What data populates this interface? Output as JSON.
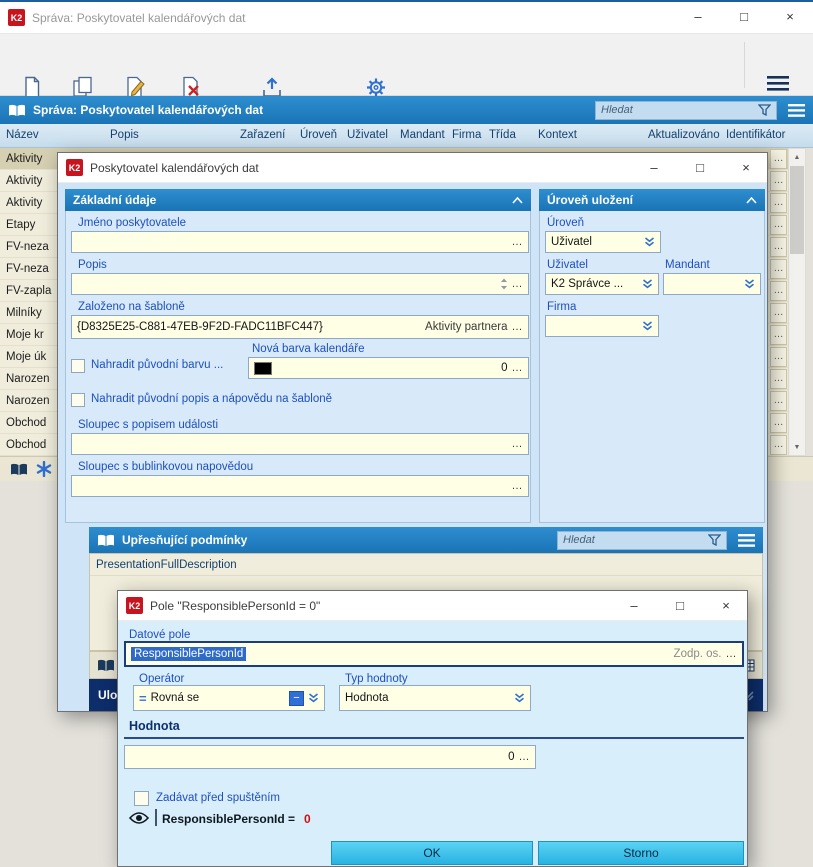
{
  "branding": {
    "k2": "K2"
  },
  "icons": {
    "ellipsis": "…",
    "minimize": "–",
    "maximize": "□",
    "close": "×",
    "caret_down": "▾",
    "scroll_up": "▲",
    "scroll_down": "▼",
    "minus": "−",
    "equals": "="
  },
  "main_window": {
    "title": "Správa: Poskytovatel kalendářových dat",
    "toolbar": {
      "new": "Nový",
      "copy": "Kopie",
      "change": "Změna",
      "delete": "Smazat",
      "export_import": "Export/import",
      "service_mode": "Servisní režim",
      "menu": "Menu"
    },
    "panel": {
      "title": "Správa: Poskytovatel kalendářových dat",
      "search_placeholder": "Hledat"
    },
    "table": {
      "columns": [
        "Název",
        "Popis",
        "Zařazení",
        "Úroveň",
        "Uživatel",
        "Mandant",
        "Firma",
        "Třída",
        "Kontext",
        "Aktualizováno",
        "Identifikátor"
      ],
      "rows": [
        "Aktivity",
        "Aktivity",
        "Aktivity",
        "Etapy",
        "FV-neza",
        "FV-neza",
        "FV-zapla",
        "Milníky",
        "Moje kr",
        "Moje úk",
        "Narozen",
        "Narozen",
        "Obchod",
        "Obchod"
      ]
    }
  },
  "provider_dialog": {
    "title": "Poskytovatel kalendářových dat",
    "basic": {
      "title": "Základní údaje",
      "name_label": "Jméno poskytovatele",
      "desc_label": "Popis",
      "template_label": "Založeno na šabloně",
      "template_guid": "{D8325E25-C881-47EB-9F2D-FADC11BFC447}",
      "template_name": "Aktivity partnera",
      "replace_color_label": "Nahradit původní barvu ...",
      "new_color_label": "Nová barva kalendáře",
      "new_color_value": "0",
      "replace_desc_label": "Nahradit původní popis a nápovědu na šabloně",
      "event_col_label": "Sloupec s popisem události",
      "hint_col_label": "Sloupec s bublinkovou napovědou"
    },
    "level": {
      "title": "Úroveň uložení",
      "level_label": "Úroveň",
      "level_value": "Uživatel",
      "user_label": "Uživatel",
      "user_value": "K2 Správce ...",
      "mandant_label": "Mandant",
      "firma_label": "Firma"
    },
    "conditions": {
      "title": "Upřesňující podmínky",
      "search_placeholder": "Hledat",
      "row1": "PresentationFullDescription",
      "save_label": "Uložit"
    }
  },
  "field_dialog": {
    "title": "Pole \"ResponsiblePersonId = 0\"",
    "field_label": "Datové pole",
    "field_value": "ResponsiblePersonId",
    "field_suffix": "Zodp. os.",
    "operator_label": "Operátor",
    "operator_value": "Rovná se",
    "type_label": "Typ hodnoty",
    "type_value": "Hodnota",
    "value_title": "Hodnota",
    "value": "0",
    "run_checkbox_label": "Zadávat před spuštěním",
    "preview_text": "ResponsiblePersonId =",
    "preview_value": "0",
    "ok": "OK",
    "cancel": "Storno"
  }
}
